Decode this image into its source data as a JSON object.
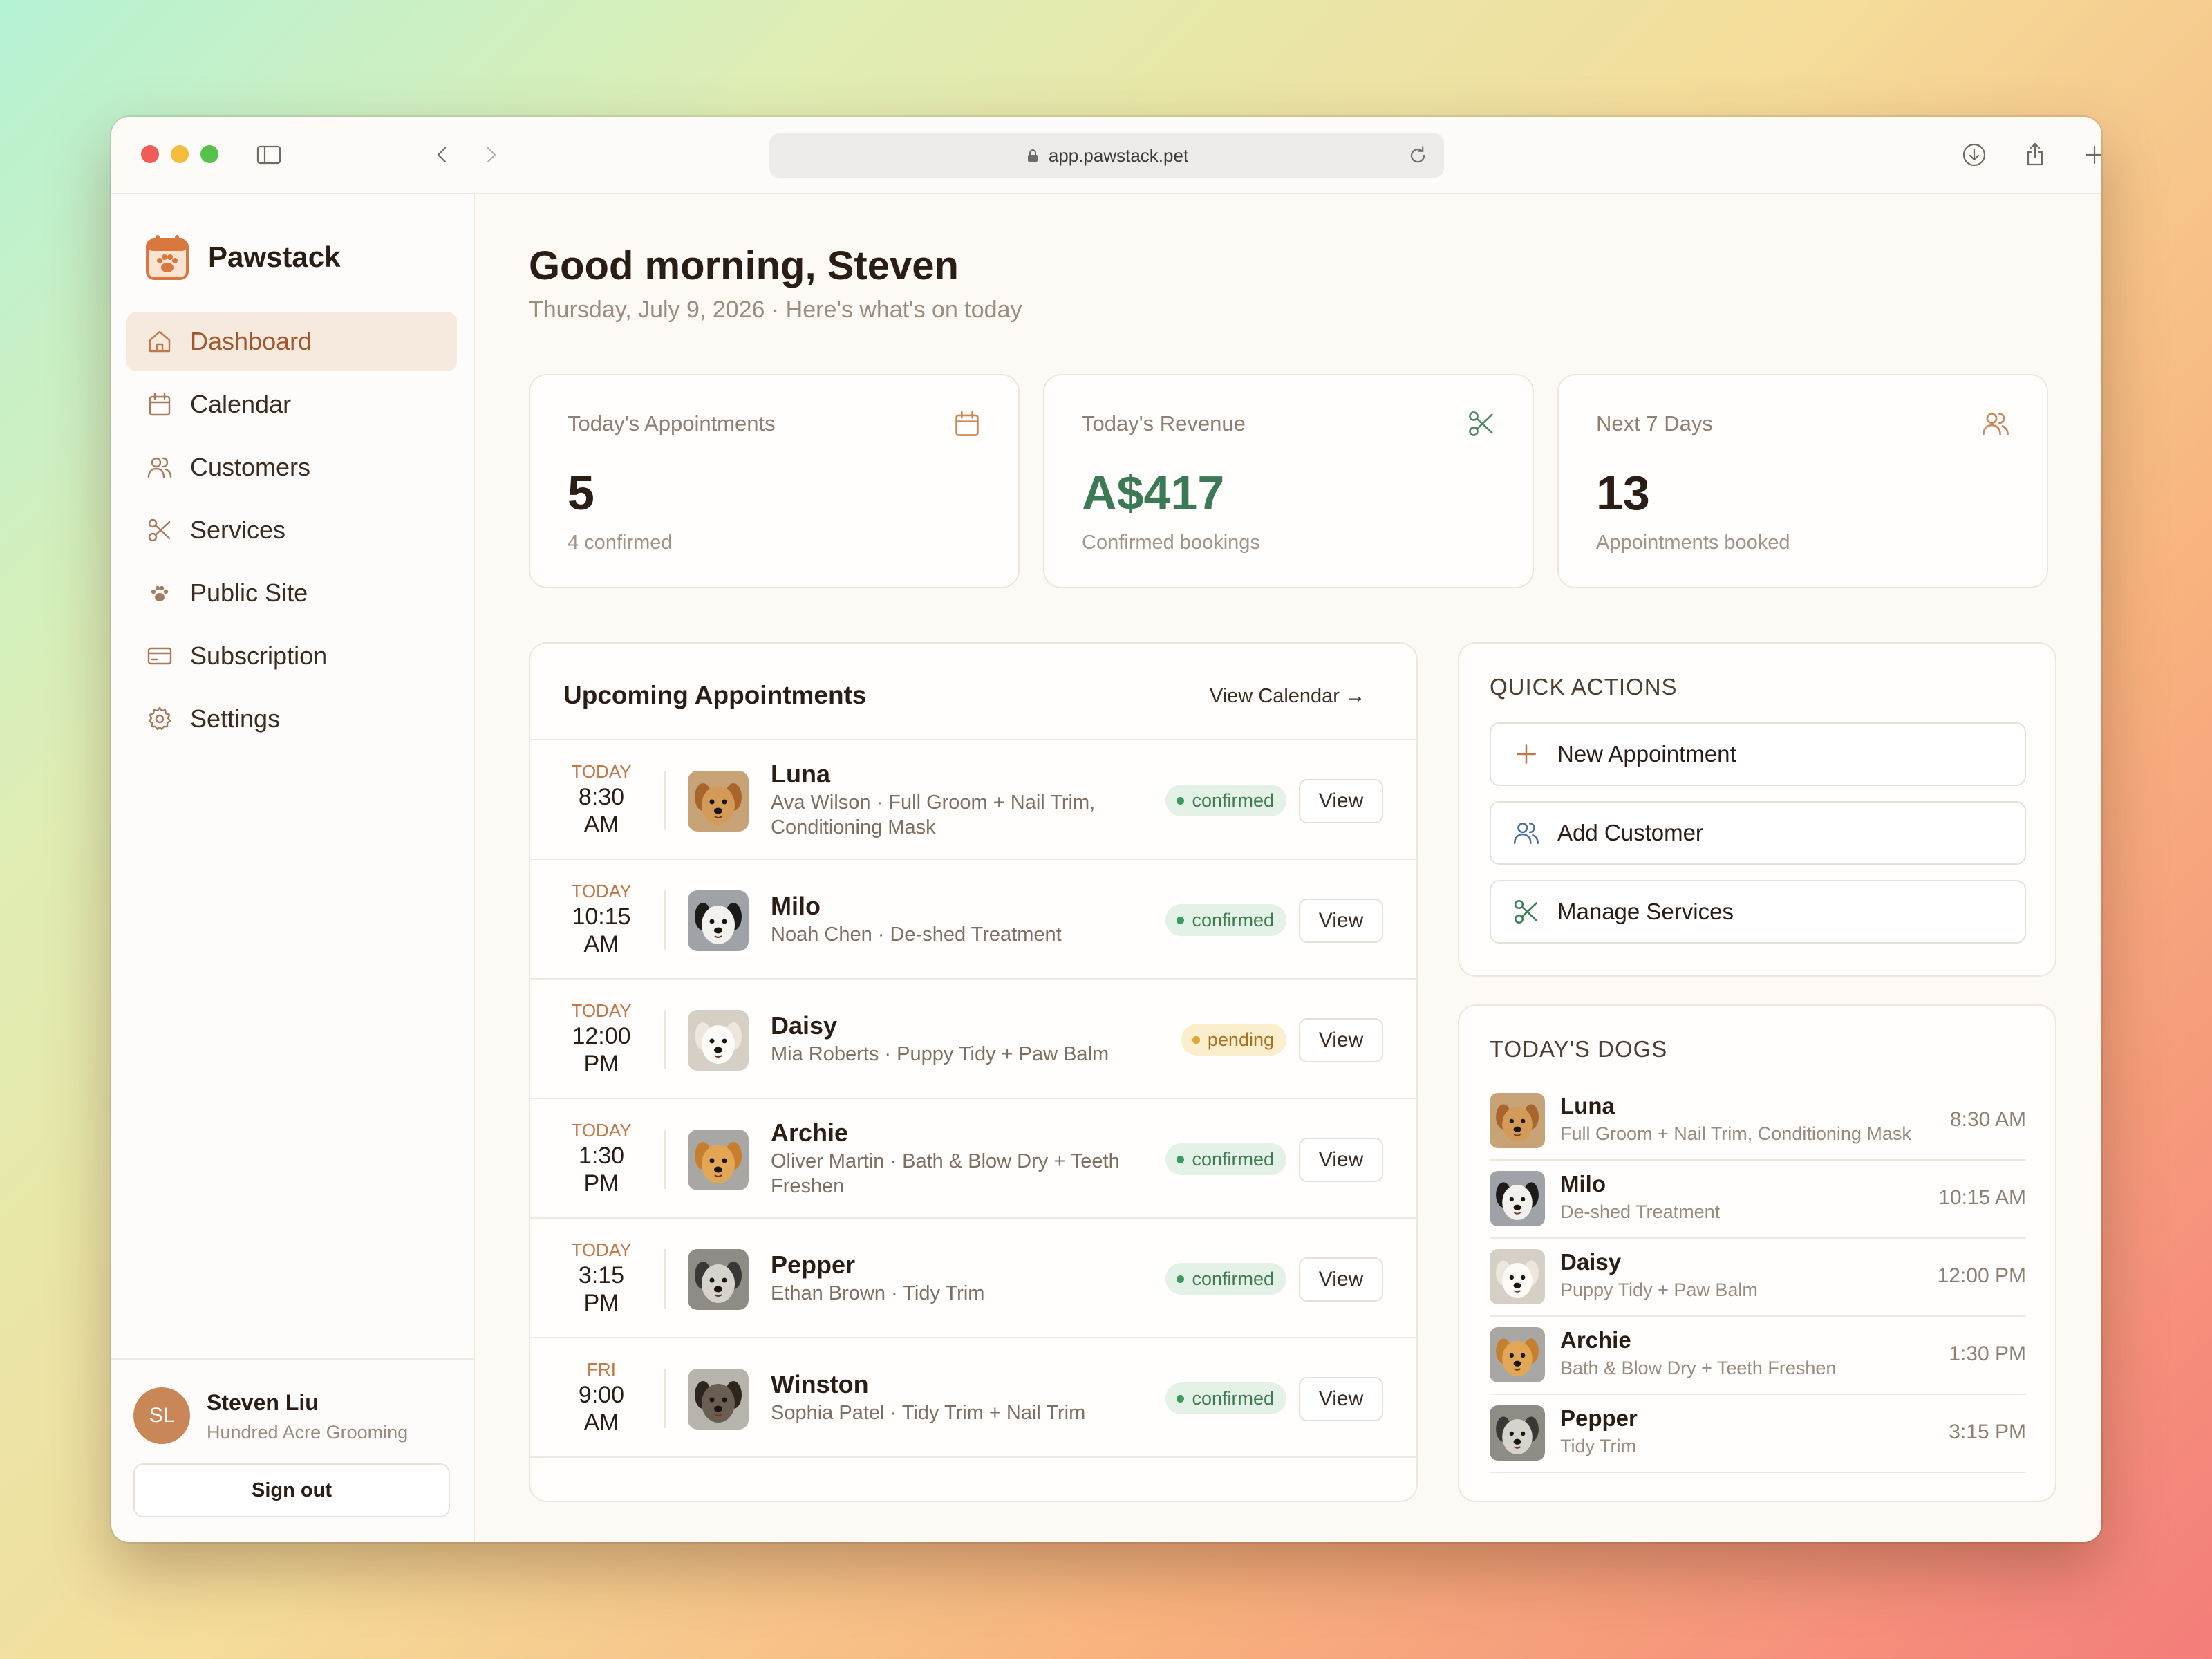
{
  "browser": {
    "url": "app.pawstack.pet"
  },
  "app": {
    "name": "Pawstack"
  },
  "nav": [
    {
      "label": "Dashboard",
      "icon": "home-icon",
      "active": true
    },
    {
      "label": "Calendar",
      "icon": "calendar-icon"
    },
    {
      "label": "Customers",
      "icon": "users-icon"
    },
    {
      "label": "Services",
      "icon": "scissors-icon"
    },
    {
      "label": "Public Site",
      "icon": "paw-icon"
    },
    {
      "label": "Subscription",
      "icon": "credit-card-icon"
    },
    {
      "label": "Settings",
      "icon": "gear-icon"
    }
  ],
  "user": {
    "initials": "SL",
    "name": "Steven Liu",
    "org": "Hundred Acre Grooming",
    "signout_label": "Sign out"
  },
  "header": {
    "greeting": "Good morning, Steven",
    "subtitle": "Thursday, July 9, 2026 · Here's what's on today"
  },
  "stats": [
    {
      "label": "Today's Appointments",
      "value": "5",
      "sub": "4 confirmed",
      "icon": "calendar-icon"
    },
    {
      "label": "Today's Revenue",
      "value": "A$417",
      "sub": "Confirmed bookings",
      "icon": "scissors-icon"
    },
    {
      "label": "Next 7 Days",
      "value": "13",
      "sub": "Appointments booked",
      "icon": "users-icon"
    }
  ],
  "appointments": {
    "title": "Upcoming Appointments",
    "view_calendar": "View Calendar →",
    "view_label": "View",
    "rows": [
      {
        "day": "TODAY",
        "time1": "8:30",
        "time2": "AM",
        "name": "Luna",
        "detail": "Ava Wilson · Full Groom + Nail Trim, Conditioning Mask",
        "status": "confirmed"
      },
      {
        "day": "TODAY",
        "time1": "10:15",
        "time2": "AM",
        "name": "Milo",
        "detail": "Noah Chen · De-shed Treatment",
        "status": "confirmed"
      },
      {
        "day": "TODAY",
        "time1": "12:00",
        "time2": "PM",
        "name": "Daisy",
        "detail": "Mia Roberts · Puppy Tidy + Paw Balm",
        "status": "pending"
      },
      {
        "day": "TODAY",
        "time1": "1:30",
        "time2": "PM",
        "name": "Archie",
        "detail": "Oliver Martin · Bath & Blow Dry + Teeth Freshen",
        "status": "confirmed"
      },
      {
        "day": "TODAY",
        "time1": "3:15",
        "time2": "PM",
        "name": "Pepper",
        "detail": "Ethan Brown · Tidy Trim",
        "status": "confirmed"
      },
      {
        "day": "FRI",
        "time1": "9:00",
        "time2": "AM",
        "name": "Winston",
        "detail": "Sophia Patel · Tidy Trim + Nail Trim",
        "status": "confirmed"
      }
    ]
  },
  "quick_actions": {
    "title": "QUICK ACTIONS",
    "items": [
      {
        "label": "New Appointment",
        "icon": "plus-icon"
      },
      {
        "label": "Add Customer",
        "icon": "users-icon"
      },
      {
        "label": "Manage Services",
        "icon": "scissors-icon"
      }
    ]
  },
  "todays_dogs": {
    "title": "TODAY'S DOGS",
    "items": [
      {
        "name": "Luna",
        "service": "Full Groom + Nail Trim, Conditioning Mask",
        "time": "8:30 AM"
      },
      {
        "name": "Milo",
        "service": "De-shed Treatment",
        "time": "10:15 AM"
      },
      {
        "name": "Daisy",
        "service": "Puppy Tidy + Paw Balm",
        "time": "12:00 PM"
      },
      {
        "name": "Archie",
        "service": "Bath & Blow Dry + Teeth Freshen",
        "time": "1:30 PM"
      },
      {
        "name": "Pepper",
        "service": "Tidy Trim",
        "time": "3:15 PM"
      }
    ]
  },
  "colors": {
    "accent": "#c17748",
    "revenue": "#3c7a57",
    "confirmed": "#3f7b52",
    "pending": "#a7711e"
  }
}
